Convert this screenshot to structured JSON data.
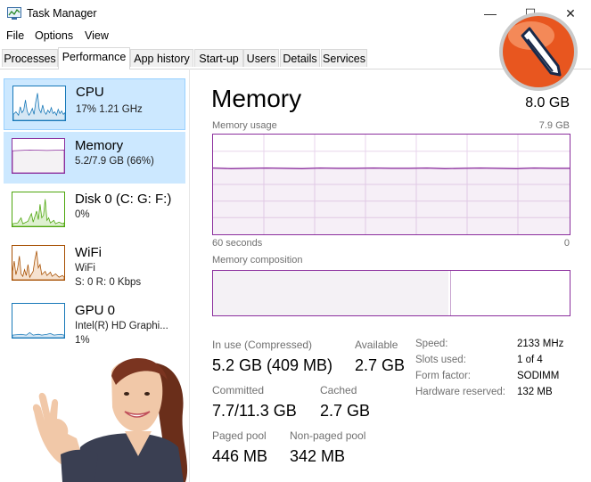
{
  "window": {
    "title": "Task Manager",
    "minimize": "—",
    "maximize": "☐",
    "close": "✕"
  },
  "menu": [
    "File",
    "Options",
    "View"
  ],
  "tabs": [
    "Processes",
    "Performance",
    "App history",
    "Start-up",
    "Users",
    "Details",
    "Services"
  ],
  "active_tab": "Performance",
  "sidebar": {
    "items": [
      {
        "title": "CPU",
        "sub1": "17%  1.21 GHz",
        "sub2": ""
      },
      {
        "title": "Memory",
        "sub1": "5.2/7.9 GB (66%)",
        "sub2": ""
      },
      {
        "title": "Disk 0 (C: G: F:)",
        "sub1": "0%",
        "sub2": ""
      },
      {
        "title": "WiFi",
        "sub1": "WiFi",
        "sub2": "S: 0  R: 0 Kbps"
      },
      {
        "title": "GPU 0",
        "sub1": "Intel(R) HD Graphi...",
        "sub2": "1%"
      }
    ]
  },
  "colors": {
    "cpu": "#1778b8",
    "memory": "#8b2e9d",
    "disk": "#4da60c",
    "wifi": "#a74f01",
    "gpu": "#1778b8",
    "selected_bg": "#cce8ff"
  },
  "main": {
    "title": "Memory",
    "total": "8.0 GB",
    "usage_label": "Memory usage",
    "usage_max": "7.9 GB",
    "time_left": "60 seconds",
    "time_right": "0",
    "usage_level": 0.66,
    "composition_label": "Memory composition",
    "composition_in_use": 0.66,
    "stats": [
      {
        "label": "In use (Compressed)",
        "value": "5.2 GB (409 MB)"
      },
      {
        "label": "Available",
        "value": "2.7 GB"
      },
      {
        "label": "Committed",
        "value": "7.7/11.3 GB"
      },
      {
        "label": "Cached",
        "value": "2.7 GB"
      },
      {
        "label": "Paged pool",
        "value": "446 MB"
      },
      {
        "label": "Non-paged pool",
        "value": "342 MB"
      }
    ],
    "specs": [
      {
        "label": "Speed:",
        "value": "2133 MHz"
      },
      {
        "label": "Slots used:",
        "value": "1 of 4"
      },
      {
        "label": "Form factor:",
        "value": "SODIMM"
      },
      {
        "label": "Hardware reserved:",
        "value": "132 MB"
      }
    ]
  }
}
